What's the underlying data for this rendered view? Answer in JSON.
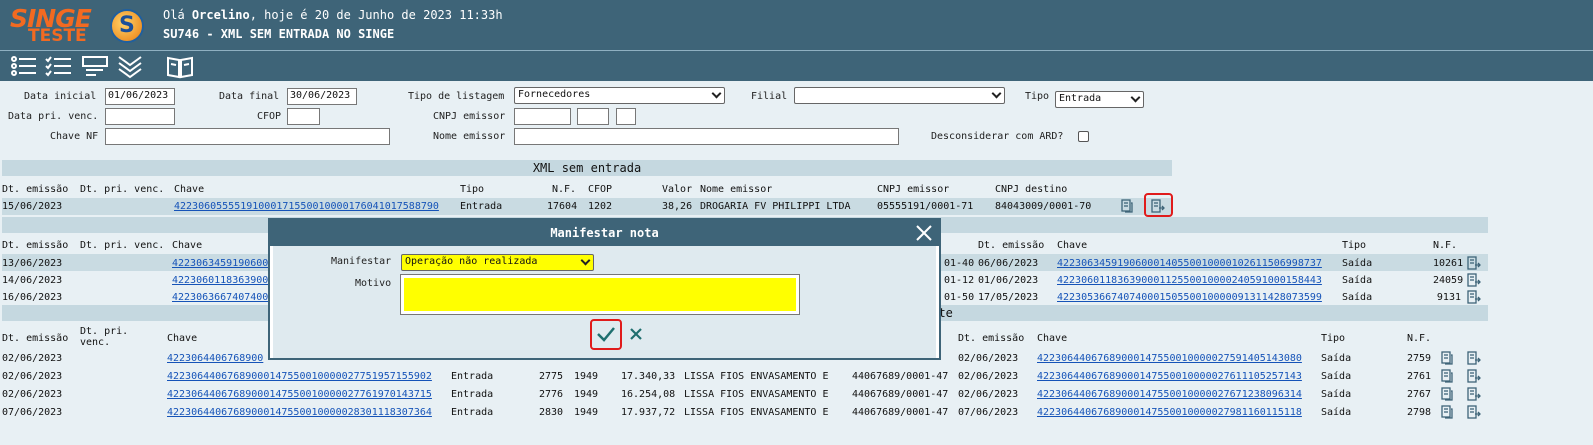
{
  "header": {
    "logo_line1": "SINGE",
    "logo_line2": "TESTE",
    "logo_mark": "S",
    "greeting_prefix": "Olá ",
    "user": "Orcelino",
    "greeting_suffix": ", hoje é 20 de Junho de 2023 11:33h",
    "title": "SU746 - XML SEM ENTRADA NO SINGE"
  },
  "toolbar": {
    "icons": [
      "list-icon",
      "checklist-icon",
      "form-icon",
      "collapse-icon",
      "book-icon"
    ]
  },
  "filters": {
    "data_inicial_label": "Data inicial",
    "data_inicial": "01/06/2023",
    "data_final_label": "Data final",
    "data_final": "30/06/2023",
    "tipo_listagem_label": "Tipo de listagem",
    "tipo_listagem": "Fornecedores",
    "filial_label": "Filial",
    "filial": "",
    "tipo_label": "Tipo",
    "tipo": "Entrada",
    "data_pri_venc_label": "Data pri. venc.",
    "cfop_label": "CFOP",
    "cnpj_emissor_label": "CNPJ emissor",
    "chave_nf_label": "Chave NF",
    "nome_emissor_label": "Nome emissor",
    "desconsiderar_label": "Desconsiderar com ARD?"
  },
  "section1": {
    "title": "XML sem entrada",
    "headers": [
      "Dt. emissão",
      "Dt. pri. venc.",
      "Chave",
      "Tipo",
      "N.F.",
      "CFOP",
      "Valor",
      "Nome emissor",
      "CNPJ emissor",
      "CNPJ destino"
    ],
    "row": {
      "dt": "15/06/2023",
      "chave": "42230605555191000171550010000176041017588790",
      "tipo": "Entrada",
      "nf": "17604",
      "cfop": "1202",
      "valor": "38,26",
      "nome": "DROGARIA FV PHILIPPI LTDA",
      "cnpj_emissor": "05555191/0001-71",
      "cnpj_destino": "84043009/0001-70"
    }
  },
  "section2": {
    "headers_left": [
      "Dt. emissão",
      "Dt. pri. venc.",
      "Chave"
    ],
    "headers_right": [
      "Dt. emissão",
      "Chave",
      "Tipo",
      "N.F."
    ],
    "rows": [
      {
        "dt": "13/06/2023",
        "chave_partial": "4223063459190600",
        "cnpj_tail": "01-40",
        "dt2": "06/06/2023",
        "chave2": "42230634591906000140550010000102611506998737",
        "tipo": "Saída",
        "nf": "10261"
      },
      {
        "dt": "14/06/2023",
        "chave_partial": "4223060118363900",
        "cnpj_tail": "01-12",
        "dt2": "01/06/2023",
        "chave2": "42230601183639000112550010000240591000158443",
        "tipo": "Saída",
        "nf": "24059"
      },
      {
        "dt": "16/06/2023",
        "chave_partial": "4223063667407400",
        "cnpj_tail": "01-50",
        "dt2": "17/05/2023",
        "chave2": "42230536674074000150550010000091311428073599",
        "tipo": "Saída",
        "nf": "9131"
      }
    ]
  },
  "section3": {
    "title_tail": "ente",
    "headers_left": [
      "Dt. emissão",
      "Dt. pri. venc.",
      "Chave"
    ],
    "headers_right": [
      "Dt. emissão",
      "Chave",
      "Tipo",
      "N.F."
    ],
    "rows": [
      {
        "dt": "02/06/2023",
        "chave": "4223064406768900",
        "tipo": "",
        "nf": "",
        "cfop": "",
        "valor": "",
        "nome": "",
        "cnpj": "",
        "dt2": "02/06/2023",
        "chave2": "42230644067689000147550010000027591405143080",
        "tipo2": "Saída",
        "nf2": "2759"
      },
      {
        "dt": "02/06/2023",
        "chave": "42230644067689000147550010000027751957155902",
        "tipo": "Entrada",
        "nf": "2775",
        "cfop": "1949",
        "valor": "17.340,33",
        "nome": "LISSA FIOS ENVASAMENTO E",
        "cnpj": "44067689/0001-47",
        "dt2": "02/06/2023",
        "chave2": "42230644067689000147550010000027611105257143",
        "tipo2": "Saída",
        "nf2": "2761"
      },
      {
        "dt": "02/06/2023",
        "chave": "42230644067689000147550010000027761970143715",
        "tipo": "Entrada",
        "nf": "2776",
        "cfop": "1949",
        "valor": "16.254,08",
        "nome": "LISSA FIOS ENVASAMENTO E",
        "cnpj": "44067689/0001-47",
        "dt2": "02/06/2023",
        "chave2": "42230644067689000147550010000027671238096314",
        "tipo2": "Saída",
        "nf2": "2767"
      },
      {
        "dt": "07/06/2023",
        "chave": "42230644067689000147550010000028301118307364",
        "tipo": "Entrada",
        "nf": "2830",
        "cfop": "1949",
        "valor": "17.937,72",
        "nome": "LISSA FIOS ENVASAMENTO E",
        "cnpj": "44067689/0001-47",
        "dt2": "07/06/2023",
        "chave2": "42230644067689000147550010000027981160115118",
        "tipo2": "Saída",
        "nf2": "2798"
      }
    ]
  },
  "modal": {
    "title": "Manifestar nota",
    "manifestar_label": "Manifestar",
    "manifestar_value": "Operação não realizada",
    "motivo_label": "Motivo",
    "motivo_value": ""
  },
  "colors": {
    "header_bg": "#3e6478",
    "logo_orange": "#f26a21",
    "link_blue": "#1553b8",
    "highlight_row": "#c9dbe2",
    "section_bar": "#c5d8e0",
    "field_yellow": "#ffff00",
    "confirm_green": "#1f6f6f",
    "alert_red": "#e01b1b"
  }
}
